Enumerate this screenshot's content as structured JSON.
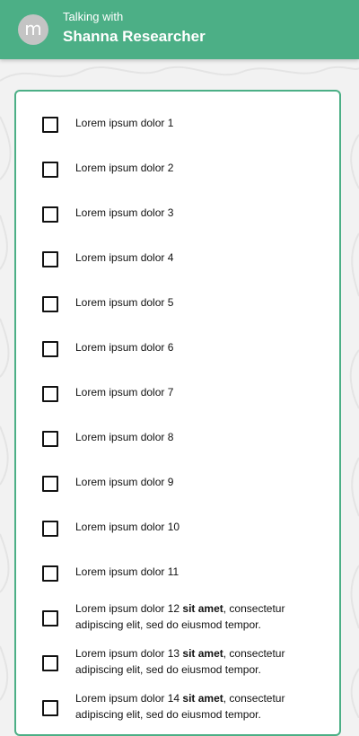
{
  "header": {
    "avatar_letter": "m",
    "subtitle": "Talking with",
    "title": "Shanna Researcher"
  },
  "colors": {
    "accent": "#4caf86",
    "background": "#f2f2f2",
    "card": "#ffffff"
  },
  "checklist": {
    "items": [
      {
        "text": "Lorem ipsum dolor 1",
        "checked": false
      },
      {
        "text": "Lorem ipsum dolor 2",
        "checked": false
      },
      {
        "text": "Lorem ipsum dolor 3",
        "checked": false
      },
      {
        "text": "Lorem ipsum dolor 4",
        "checked": false
      },
      {
        "text": "Lorem ipsum dolor 5",
        "checked": false
      },
      {
        "text": "Lorem ipsum dolor 6",
        "checked": false
      },
      {
        "text": "Lorem ipsum dolor 7",
        "checked": false
      },
      {
        "text": "Lorem ipsum dolor 8",
        "checked": false
      },
      {
        "text": "Lorem ipsum dolor 9",
        "checked": false
      },
      {
        "text": "Lorem ipsum dolor 10",
        "checked": false
      },
      {
        "text": "Lorem ipsum dolor 11",
        "checked": false
      },
      {
        "text": "Lorem ipsum dolor 12 ",
        "bold": "sit amet",
        "rest": ", consectetur adipiscing elit, sed do eiusmod tempor.",
        "checked": false
      },
      {
        "text": "Lorem ipsum dolor 13 ",
        "bold": "sit amet",
        "rest": ", consectetur adipiscing elit, sed do eiusmod tempor.",
        "checked": false
      },
      {
        "text": "Lorem ipsum dolor 14 ",
        "bold": "sit amet",
        "rest": ", consectetur adipiscing elit, sed do eiusmod tempor.",
        "checked": false
      }
    ]
  }
}
